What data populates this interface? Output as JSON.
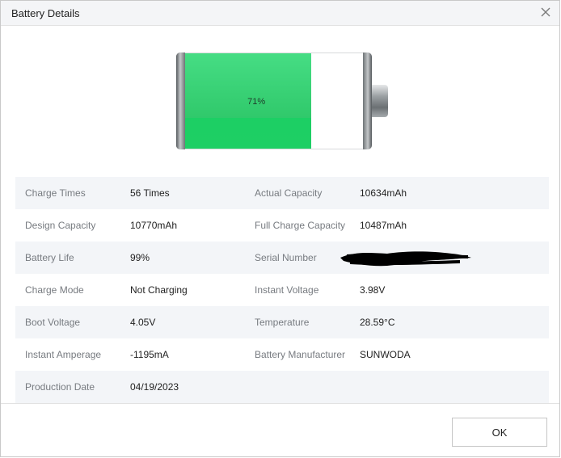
{
  "window": {
    "title": "Battery Details",
    "close_icon": "close-icon"
  },
  "battery": {
    "level_percent": 71,
    "label": "71%",
    "fill_color": "#22c965"
  },
  "details": {
    "rows": [
      {
        "left_label": "Charge Times",
        "left_value": "56 Times",
        "right_label": "Actual Capacity",
        "right_value": "10634mAh"
      },
      {
        "left_label": "Design Capacity",
        "left_value": "10770mAh",
        "right_label": "Full Charge Capacity",
        "right_value": "10487mAh"
      },
      {
        "left_label": "Battery Life",
        "left_value": "99%",
        "right_label": "Serial Number",
        "right_value": ""
      },
      {
        "left_label": "Charge Mode",
        "left_value": "Not Charging",
        "right_label": "Instant Voltage",
        "right_value": "3.98V"
      },
      {
        "left_label": "Boot Voltage",
        "left_value": "4.05V",
        "right_label": "Temperature",
        "right_value": "28.59°C"
      },
      {
        "left_label": "Instant Amperage",
        "left_value": "-1195mA",
        "right_label": "Battery Manufacturer",
        "right_value": "SUNWODA"
      },
      {
        "left_label": "Production Date",
        "left_value": "04/19/2023",
        "right_label": "",
        "right_value": ""
      }
    ]
  },
  "footer": {
    "ok_label": "OK"
  }
}
